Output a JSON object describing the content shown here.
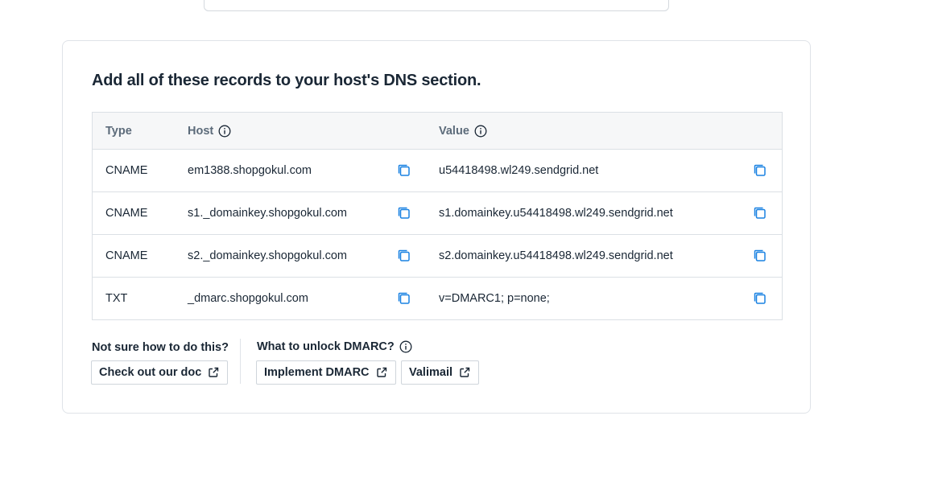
{
  "card": {
    "heading": "Add all of these records to your host's DNS section."
  },
  "table": {
    "headers": {
      "type": "Type",
      "host": "Host",
      "value": "Value"
    },
    "rows": [
      {
        "type": "CNAME",
        "host": "em1388.shopgokul.com",
        "value": "u54418498.wl249.sendgrid.net"
      },
      {
        "type": "CNAME",
        "host": "s1._domainkey.shopgokul.com",
        "value": "s1.domainkey.u54418498.wl249.sendgrid.net"
      },
      {
        "type": "CNAME",
        "host": "s2._domainkey.shopgokul.com",
        "value": "s2.domainkey.u54418498.wl249.sendgrid.net"
      },
      {
        "type": "TXT",
        "host": "_dmarc.shopgokul.com",
        "value": "v=DMARC1; p=none;"
      }
    ]
  },
  "help": {
    "docs_label": "Not sure how to do this?",
    "docs_button": "Check out our doc",
    "dmarc_label": "What to unlock DMARC?",
    "implement_button": "Implement DMARC",
    "valimail_button": "Valimail"
  },
  "icons": {
    "info": "info-icon",
    "copy": "copy-icon",
    "external": "external-link-icon"
  },
  "colors": {
    "accent": "#1a82e2",
    "text": "#1a2735",
    "muted": "#5c6b7a",
    "border": "#dbe0e5",
    "header_bg": "#f6f7f8"
  }
}
